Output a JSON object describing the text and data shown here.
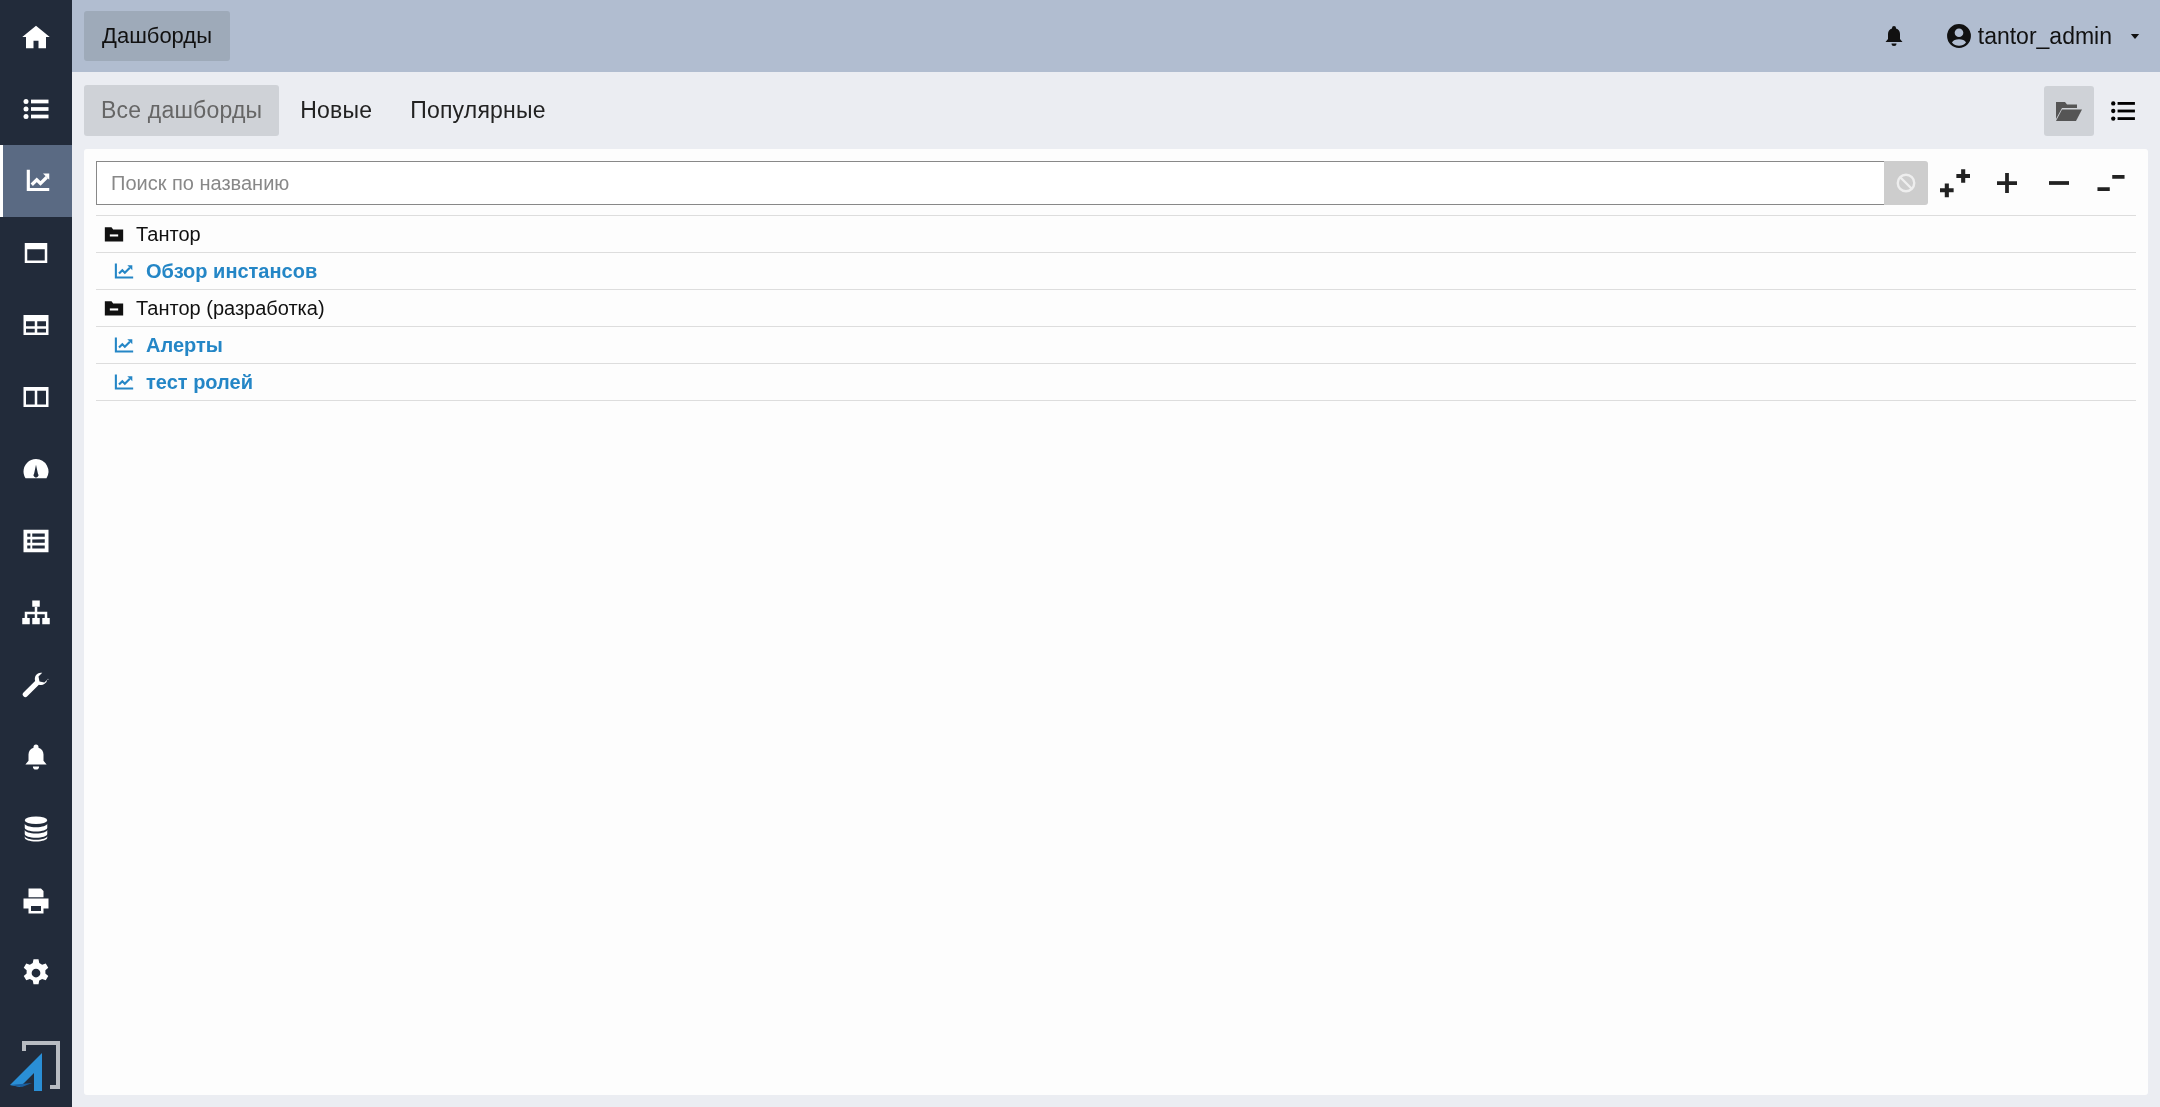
{
  "sidebar": {
    "items": [
      {
        "selected": false
      },
      {
        "selected": false
      },
      {
        "selected": true
      },
      {
        "selected": false
      },
      {
        "selected": false
      },
      {
        "selected": false
      },
      {
        "selected": false
      },
      {
        "selected": false
      },
      {
        "selected": false
      },
      {
        "selected": false
      },
      {
        "selected": false
      },
      {
        "selected": false
      },
      {
        "selected": false
      },
      {
        "selected": false
      }
    ]
  },
  "header": {
    "title": "Дашборды",
    "user": "tantor_admin"
  },
  "tabs": [
    {
      "label": "Все дашборды",
      "selected": true
    },
    {
      "label": "Новые",
      "selected": false
    },
    {
      "label": "Популярные",
      "selected": false
    }
  ],
  "view_modes": [
    {
      "kind": "folders",
      "selected": true
    },
    {
      "kind": "list",
      "selected": false
    }
  ],
  "search": {
    "placeholder": "Поиск по названию"
  },
  "tree": [
    {
      "label": "Тантор",
      "expanded": true,
      "children": [
        {
          "label": "Обзор инстансов"
        }
      ]
    },
    {
      "label": "Тантор (разработка)",
      "expanded": true,
      "children": [
        {
          "label": "Алерты"
        },
        {
          "label": "тест ролей"
        }
      ]
    }
  ]
}
